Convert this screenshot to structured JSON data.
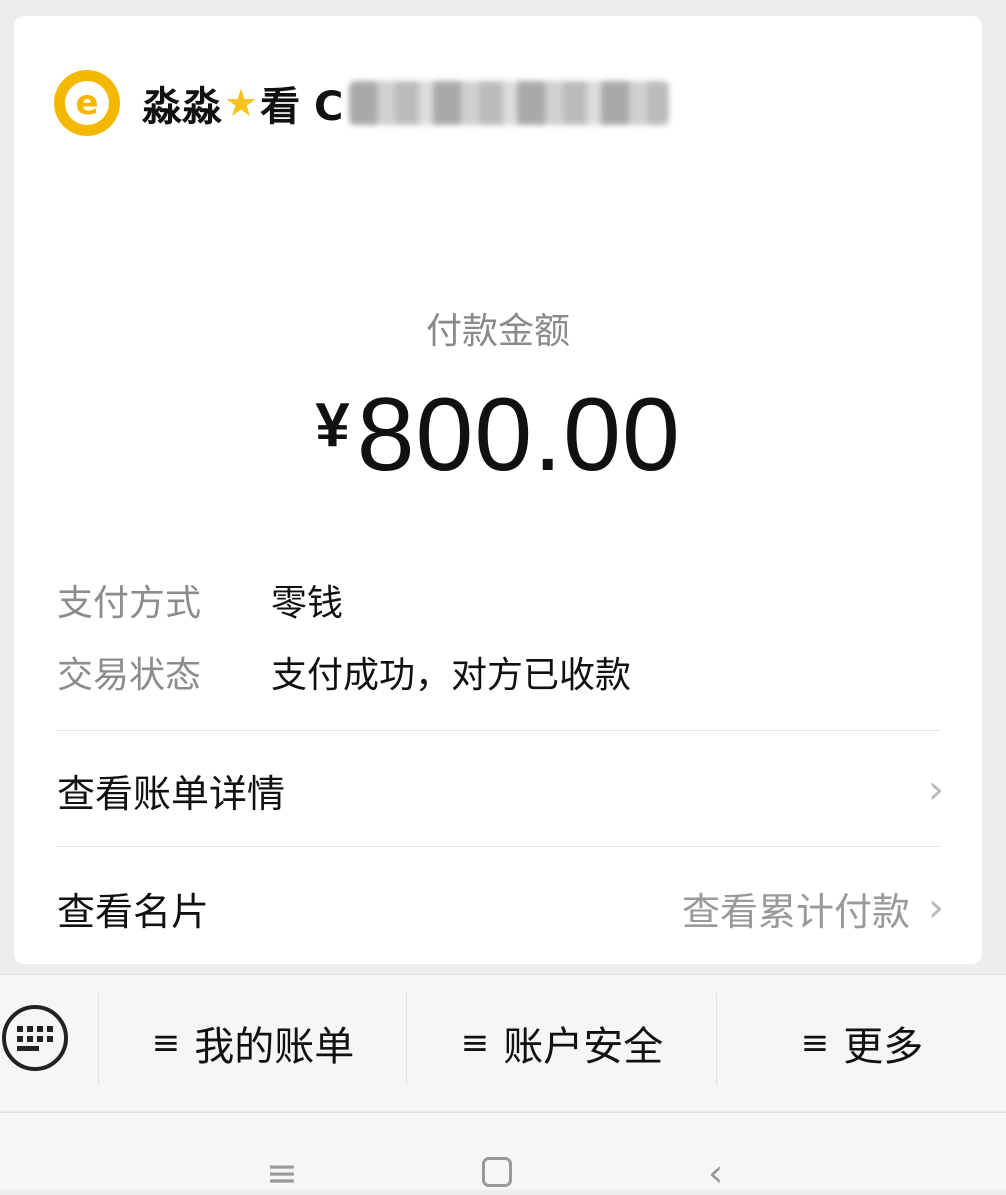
{
  "merchant": {
    "name_prefix": "淼淼",
    "star_icon": "star-icon",
    "name_suffix": "看 C"
  },
  "payment": {
    "amount_label": "付款金额",
    "currency": "¥",
    "amount": "800.00",
    "method_label": "支付方式",
    "method_value": "零钱",
    "status_label": "交易状态",
    "status_value": "支付成功，对方已收款"
  },
  "links": {
    "bill_details": "查看账单详情",
    "view_card": "查看名片",
    "cumulative_payments": "查看累计付款"
  },
  "toolbar": {
    "my_bills": "我的账单",
    "account_security": "账户安全",
    "more": "更多"
  },
  "colors": {
    "avatar": "#f5b800",
    "background": "#ededed",
    "card": "#ffffff"
  }
}
